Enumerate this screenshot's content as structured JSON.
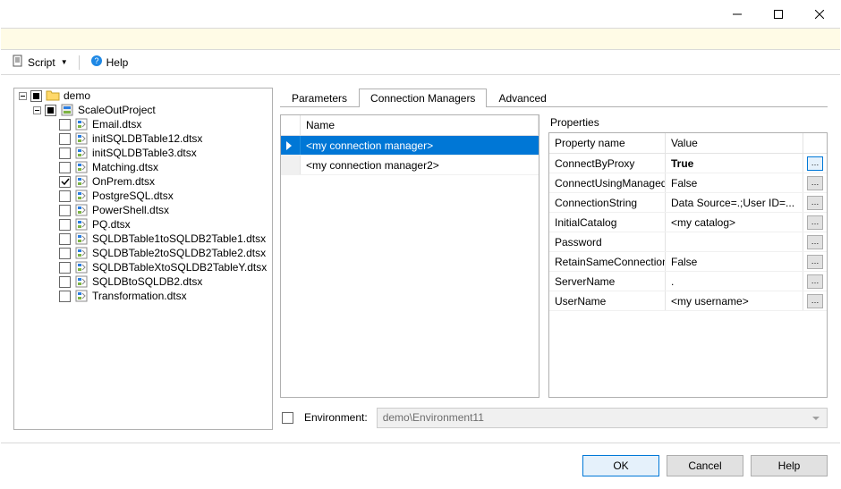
{
  "toolbar": {
    "script_label": "Script",
    "help_label": "Help"
  },
  "tree": {
    "root": "demo",
    "project": "ScaleOutProject",
    "packages": [
      "Email.dtsx",
      "initSQLDBTable12.dtsx",
      "initSQLDBTable3.dtsx",
      "Matching.dtsx",
      "OnPrem.dtsx",
      "PostgreSQL.dtsx",
      "PowerShell.dtsx",
      "PQ.dtsx",
      "SQLDBTable1toSQLDB2Table1.dtsx",
      "SQLDBTable2toSQLDB2Table2.dtsx",
      "SQLDBTableXtoSQLDB2TableY.dtsx",
      "SQLDBtoSQLDB2.dtsx",
      "Transformation.dtsx"
    ],
    "checked_index": 4
  },
  "tabs": {
    "parameters": "Parameters",
    "connection_managers": "Connection Managers",
    "advanced": "Advanced",
    "active": 1
  },
  "cm": {
    "col_name": "Name",
    "rows": [
      "<my connection manager>",
      "<my connection manager2>"
    ],
    "selected_index": 0
  },
  "props": {
    "title": "Properties",
    "col_name": "Property name",
    "col_value": "Value",
    "rows": [
      {
        "name": "ConnectByProxy",
        "value": "True",
        "bold": true,
        "active_btn": true
      },
      {
        "name": "ConnectUsingManagedIdentity",
        "value": "False"
      },
      {
        "name": "ConnectionString",
        "value": "Data Source=.;User ID=..."
      },
      {
        "name": "InitialCatalog",
        "value": "<my catalog>"
      },
      {
        "name": "Password",
        "value": ""
      },
      {
        "name": "RetainSameConnection",
        "value": "False"
      },
      {
        "name": "ServerName",
        "value": "."
      },
      {
        "name": "UserName",
        "value": "<my username>"
      }
    ]
  },
  "env": {
    "label": "Environment:",
    "value": "demo\\Environment11"
  },
  "footer": {
    "ok": "OK",
    "cancel": "Cancel",
    "help": "Help"
  }
}
